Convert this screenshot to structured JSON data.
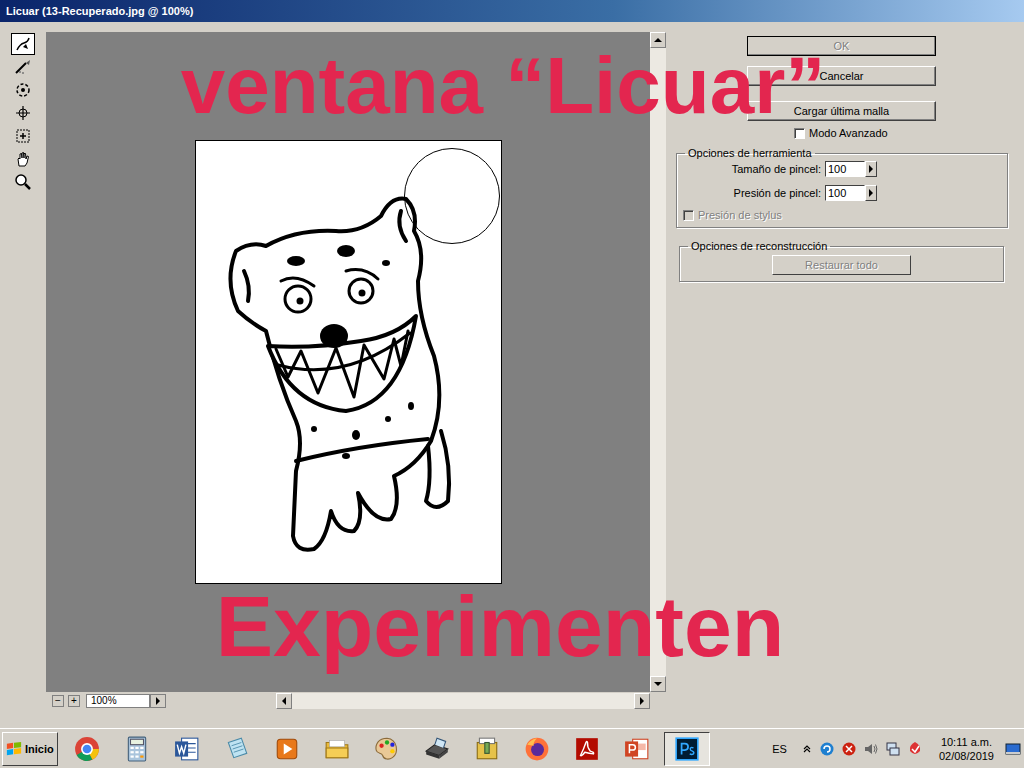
{
  "window": {
    "title": "Licuar (13-Recuperado.jpg @ 100%)"
  },
  "overlay": {
    "heading": "ventana “Licuar”",
    "footer": "Experimenten"
  },
  "tools": [
    {
      "selected": true
    },
    {
      "selected": false
    },
    {
      "selected": false
    },
    {
      "selected": false
    },
    {
      "selected": false
    },
    {
      "selected": false
    },
    {
      "selected": false
    }
  ],
  "buttons": [
    {
      "label": "OK",
      "disabled": true
    },
    {
      "label": "Cancelar",
      "disabled": false
    },
    {
      "label": "Cargar última malla",
      "disabled": false
    }
  ],
  "advanced_mode": {
    "label": "Modo Avanzado",
    "checked": false
  },
  "tool_options": {
    "title": "Opciones de herramienta",
    "fields": [
      {
        "label": "Tamaño de pincel:",
        "value": "100"
      },
      {
        "label": "Presión de pincel:",
        "value": "100"
      }
    ],
    "stylus": {
      "label": "Presión de stylus",
      "checked": false,
      "disabled": true
    }
  },
  "reconstruction": {
    "title": "Opciones de reconstrucción",
    "button": {
      "label": "Restaurar todo",
      "disabled": true
    }
  },
  "zoom": {
    "minus": "−",
    "plus": "+",
    "value": "100%"
  },
  "taskbar": {
    "start": "Inicio",
    "apps": [
      {
        "selected": false
      },
      {
        "selected": false
      },
      {
        "selected": false
      },
      {
        "selected": false
      },
      {
        "selected": false
      },
      {
        "selected": false
      },
      {
        "selected": false
      },
      {
        "selected": false
      },
      {
        "selected": false
      },
      {
        "selected": false
      },
      {
        "selected": false
      },
      {
        "selected": false
      },
      {
        "selected": true
      }
    ]
  },
  "tray": {
    "language": "ES"
  },
  "clock": {
    "time": "10:11 a.m.",
    "date": "02/08/2019"
  }
}
